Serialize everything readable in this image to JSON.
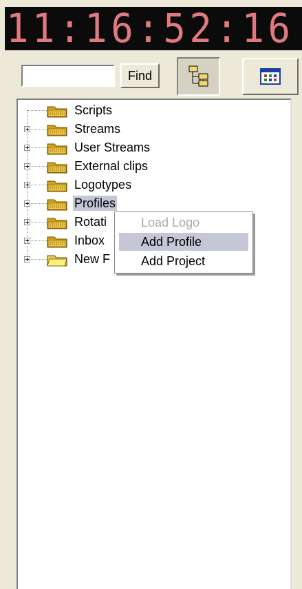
{
  "clock": {
    "time": "11:16:52:16"
  },
  "toolbar": {
    "search_value": "",
    "find_label": "Find",
    "tree_view_icon": "tree-view-icon",
    "grid_view_icon": "grid-view-icon"
  },
  "tree": {
    "items": [
      {
        "label": "Scripts"
      },
      {
        "label": "Streams"
      },
      {
        "label": "User Streams"
      },
      {
        "label": "External clips"
      },
      {
        "label": "Logotypes"
      },
      {
        "label": "Profiles"
      },
      {
        "label": "Rotati"
      },
      {
        "label": "Inbox"
      },
      {
        "label": "New F"
      }
    ]
  },
  "context_menu": {
    "items": [
      {
        "label": "Load Logo"
      },
      {
        "label": "Add Profile"
      },
      {
        "label": "Add Project"
      }
    ]
  },
  "colors": {
    "clock_digits": "#e07a80",
    "selection": "#c5c6d6",
    "folder": "#d4a017"
  }
}
